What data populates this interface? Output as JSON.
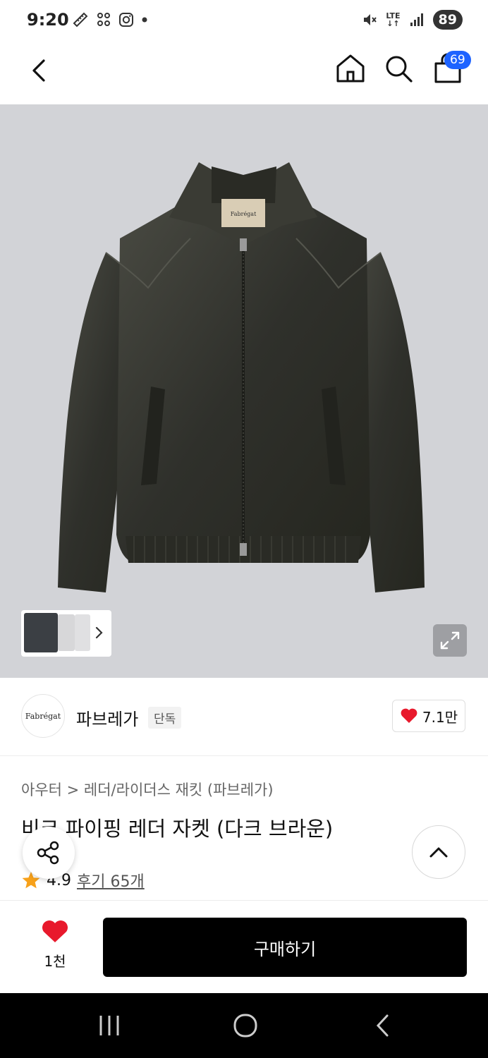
{
  "status_bar": {
    "time": "9:20",
    "lte_top": "LTE",
    "lte_bottom": "↓↑",
    "battery": "89"
  },
  "top_nav": {
    "cart_badge": "69"
  },
  "gallery": {
    "label_text": "Fabrégat"
  },
  "brand": {
    "logo_text": "Fabrégat",
    "name": "파브레가",
    "tag": "단독",
    "like_count": "7.1만"
  },
  "product": {
    "category": "아우터 > 레더/라이더스 재킷 (파브레가)",
    "title": "비크 파이핑 레더 자켓 (다크 브라운)",
    "rating": "4.9",
    "review_link": "후기 65개"
  },
  "bottom_bar": {
    "wish_count": "1천",
    "buy_label": "구매하기"
  },
  "colors": {
    "accent_blue": "#1d63ff",
    "heart_red": "#e8192c",
    "star_orange": "#f7a11a"
  }
}
